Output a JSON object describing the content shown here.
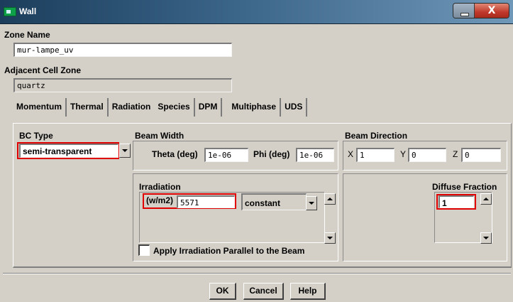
{
  "window": {
    "title": "Wall",
    "close_label": "X"
  },
  "zone_name": {
    "label": "Zone Name",
    "value": "mur-lampe_uv"
  },
  "adjacent_cell_zone": {
    "label": "Adjacent Cell Zone",
    "value": "quartz"
  },
  "tabs": [
    {
      "label": "Momentum"
    },
    {
      "label": "Thermal"
    },
    {
      "label": "Radiation"
    },
    {
      "label": "Species"
    },
    {
      "label": "DPM"
    },
    {
      "label": "Multiphase"
    },
    {
      "label": "UDS"
    }
  ],
  "bc_type": {
    "label": "BC Type",
    "value": "semi-transparent"
  },
  "beam_width": {
    "label": "Beam Width",
    "theta_label": "Theta (deg)",
    "theta_value": "1e-06",
    "phi_label": "Phi (deg)",
    "phi_value": "1e-06"
  },
  "beam_direction": {
    "label": "Beam Direction",
    "x_label": "X",
    "x_value": "1",
    "y_label": "Y",
    "y_value": "0",
    "z_label": "Z",
    "z_value": "0"
  },
  "irradiation": {
    "label": "Irradiation",
    "unit_label": "(w/m2)",
    "value": "5571",
    "method": "constant"
  },
  "diffuse_fraction": {
    "label": "Diffuse Fraction",
    "value": "1"
  },
  "apply_parallel": {
    "label": "Apply Irradiation Parallel to the Beam",
    "checked": false
  },
  "buttons": {
    "ok": "OK",
    "cancel": "Cancel",
    "help": "Help"
  },
  "colors": {
    "highlight": "#e00000",
    "titlebar": "#2d5577",
    "dialog_bg": "#d4d0c8"
  }
}
